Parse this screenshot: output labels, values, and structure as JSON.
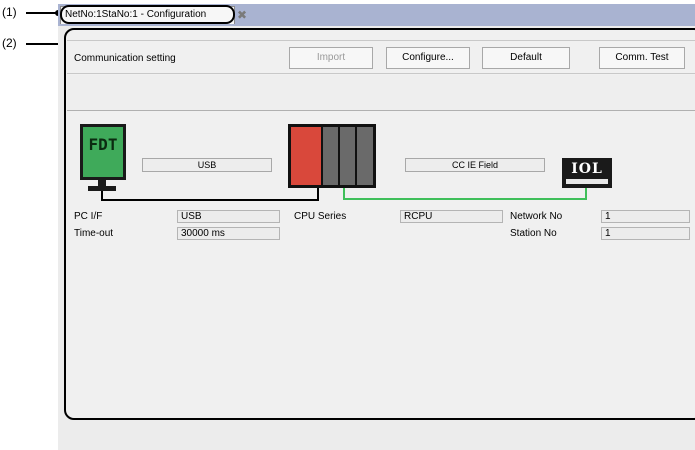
{
  "callouts": {
    "c1": "(1)",
    "c2": "(2)"
  },
  "tab": {
    "title": "NetNo:1StaNo:1 - Configuration",
    "close": "✖"
  },
  "toolbar": {
    "comm_label": "Communication setting",
    "import_label": "Import",
    "configure_label": "Configure...",
    "default_label": "Default",
    "commtest_label": "Comm. Test"
  },
  "diagram": {
    "pc_icon_text": "FDT",
    "pc_link_label": "USB",
    "network_link_label": "CC IE Field",
    "device_icon_text": "IOL",
    "colors": {
      "cpu_slot1": "#d9483b",
      "cpu_slots": "#6a6a6a",
      "network_line": "#3fbf5a",
      "pc_screen": "#3faa5a"
    }
  },
  "fields": {
    "pc_if_label": "PC I/F",
    "pc_if_value": "USB",
    "timeout_label": "Time-out",
    "timeout_value": "30000 ms",
    "cpu_series_label": "CPU Series",
    "cpu_series_value": "RCPU",
    "network_no_label": "Network No",
    "network_no_value": "1",
    "station_no_label": "Station No",
    "station_no_value": "1"
  }
}
